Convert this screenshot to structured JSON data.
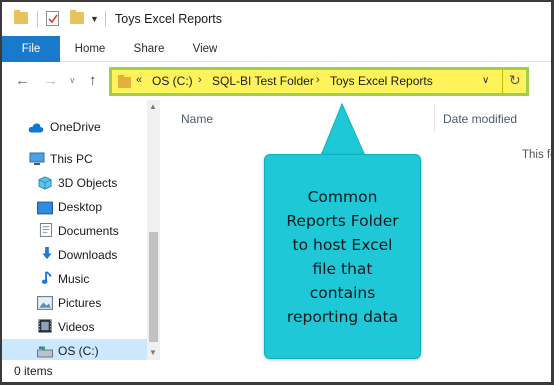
{
  "window": {
    "title": "Toys Excel Reports"
  },
  "ribbon": {
    "tabs": [
      {
        "label": "File"
      },
      {
        "label": "Home"
      },
      {
        "label": "Share"
      },
      {
        "label": "View"
      }
    ]
  },
  "address_bar": {
    "overflow": "«",
    "breadcrumb": [
      "OS (C:)",
      "SQL-BI Test Folder",
      "Toys Excel Reports"
    ]
  },
  "nav_pane": {
    "items": [
      {
        "label": "OneDrive",
        "icon": "onedrive-cloud-icon"
      },
      {
        "label": "This PC",
        "icon": "computer-icon"
      },
      {
        "label": "3D Objects",
        "icon": "cube-3d-icon"
      },
      {
        "label": "Desktop",
        "icon": "desktop-icon"
      },
      {
        "label": "Documents",
        "icon": "documents-icon"
      },
      {
        "label": "Downloads",
        "icon": "download-arrow-icon"
      },
      {
        "label": "Music",
        "icon": "music-note-icon"
      },
      {
        "label": "Pictures",
        "icon": "pictures-icon"
      },
      {
        "label": "Videos",
        "icon": "film-icon"
      },
      {
        "label": "OS (C:)",
        "icon": "drive-icon",
        "selected": true
      }
    ]
  },
  "file_list": {
    "columns": [
      {
        "label": "Name"
      },
      {
        "label": "Date modified"
      }
    ],
    "empty_message": "This fo"
  },
  "status_bar": {
    "item_count": "0 items"
  },
  "callout": {
    "lines": [
      "Common",
      "Reports Folder",
      "to host Excel",
      "file that",
      "contains",
      "reporting data"
    ]
  },
  "colors": {
    "file_tab": "#1979ca",
    "address_highlight": "#fff35c",
    "address_border": "#9ed148",
    "callout_fill": "#1ec8d6",
    "selection": "#cce8ff"
  }
}
